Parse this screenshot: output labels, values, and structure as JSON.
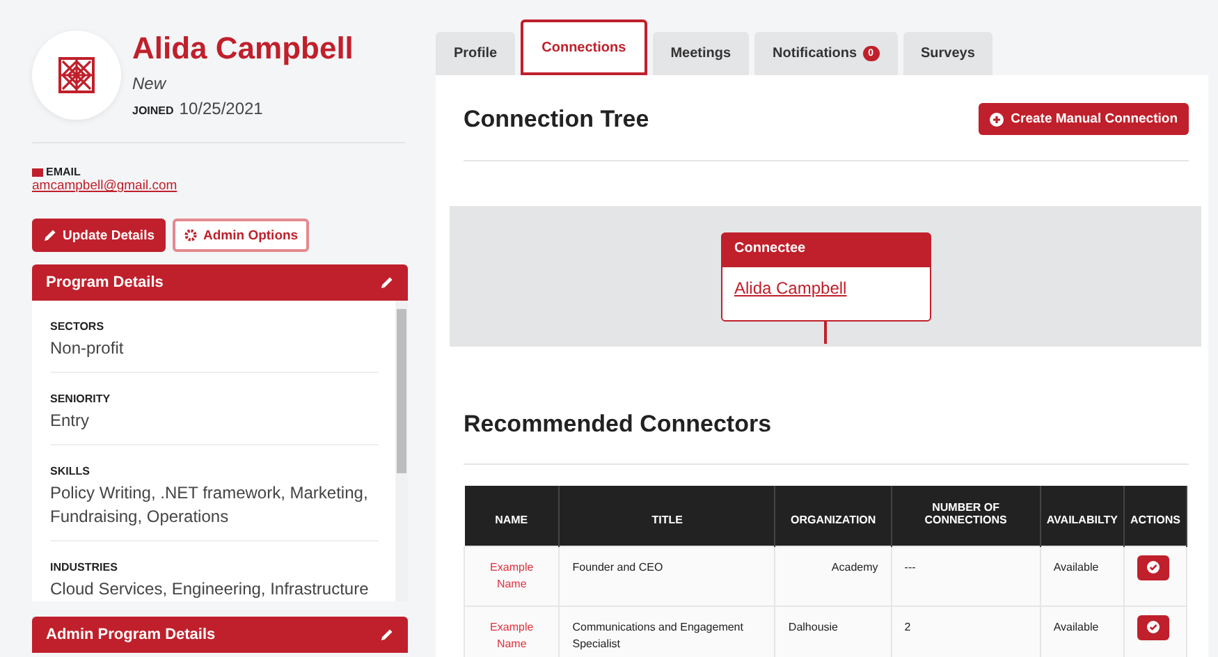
{
  "profile": {
    "name": "Alida Campbell",
    "status": "New",
    "joined_label": "JOINED",
    "joined_date": "10/25/2021",
    "email_label": "EMAIL",
    "email": "amcampbell@gmail.com"
  },
  "actions": [
    {
      "label": "Update Details",
      "kind": "primary"
    },
    {
      "label": "Admin Options",
      "kind": "outline"
    }
  ],
  "program_details": {
    "title": "Program Details",
    "fields": [
      {
        "label": "SECTORS",
        "value": "Non-profit"
      },
      {
        "label": "SENIORITY",
        "value": "Entry"
      },
      {
        "label": "SKILLS",
        "value": "Policy Writing, .NET framework, Marketing, Fundraising, Operations"
      },
      {
        "label": "INDUSTRIES",
        "value": "Cloud Services, Engineering, Infrastructure"
      }
    ]
  },
  "admin_program_details": {
    "title": "Admin Program Details"
  },
  "tabs": [
    {
      "label": "Profile",
      "selected": false
    },
    {
      "label": "Connections",
      "selected": true
    },
    {
      "label": "Meetings",
      "selected": false
    },
    {
      "label": "Notifications",
      "selected": false,
      "badge": "0"
    },
    {
      "label": "Surveys",
      "selected": false
    }
  ],
  "connection_tree": {
    "title": "Connection Tree",
    "button": "Create Manual Connection",
    "node_title": "Connectee",
    "node_name": "Alida Campbell"
  },
  "recommended": {
    "title": "Recommended Connectors",
    "columns": [
      "NAME",
      "TITLE",
      "ORGANIZATION",
      "NUMBER OF CONNECTIONS",
      "AVAILABILTY",
      "ACTIONS"
    ],
    "rows": [
      {
        "name": "Example Name",
        "title": "Founder and CEO",
        "organization": "Academy",
        "connections": "---",
        "availability": "Available"
      },
      {
        "name": "Example Name",
        "title": "Communications and Engagement Specialist",
        "organization": "Dalhousie",
        "connections": "2",
        "availability": "Available"
      }
    ]
  }
}
